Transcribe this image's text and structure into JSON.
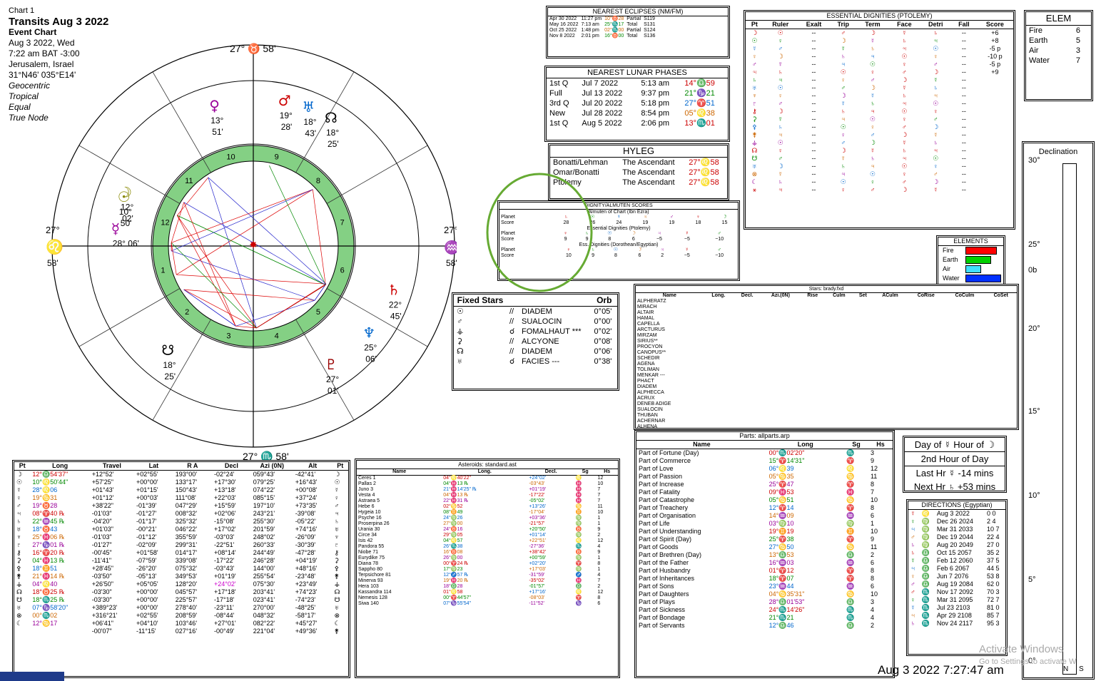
{
  "chart_info": {
    "chart_label": "Chart 1",
    "title": "Transits Aug 3 2022",
    "subtitle": "Event Chart",
    "date": "Aug 3 2022, Wed",
    "time": "7:22 am  BAT -3:00",
    "place": "Jerusalem, Israel",
    "coords": "31°N46' 035°E14'",
    "options": [
      "Geocentric",
      "Tropical",
      "Equal",
      "True Node"
    ]
  },
  "wheel": {
    "cusp_top": "27° ♉ 58'",
    "cusp_bottom": "27° ♏ 58'",
    "cusp_left": "27°",
    "cusp_left_min": "58'",
    "cusp_right": "27°",
    "cusp_right_min": "58'",
    "asc_sign": "♌",
    "dsc_sign": "♒",
    "house_numbers": [
      "1",
      "2",
      "3",
      "4",
      "5",
      "6",
      "7",
      "8",
      "9",
      "10",
      "11",
      "12"
    ],
    "planet_labels": [
      {
        "g": "♀",
        "deg": "13°",
        "sign": "♊",
        "min": "51'"
      },
      {
        "g": "♂",
        "deg": "19°",
        "min": "28'"
      },
      {
        "g": "♅",
        "deg": "18°",
        "min": "43'"
      },
      {
        "g": "☊",
        "deg": "18°",
        "min": "25'"
      },
      {
        "g": "☿",
        "deg": "28° 06'"
      },
      {
        "g": "☉",
        "deg": "10°",
        "min": "50'"
      },
      {
        "g": "♄",
        "deg": "22°",
        "min": "45'"
      },
      {
        "g": "♆",
        "deg": "25°",
        "min": "06'"
      },
      {
        "g": "♇",
        "deg": "27°",
        "min": "01'"
      },
      {
        "g": "☽",
        "deg": "12°",
        "min": "02'"
      },
      {
        "g": "☋",
        "deg": "18°",
        "min": "25'"
      }
    ]
  },
  "eclipses": {
    "title": "NEAREST ECLIPSES (NM/FM)",
    "rows": [
      [
        "Apr 30 2022",
        "11:27 pm",
        "10°♉28",
        "Partial",
        "S119"
      ],
      [
        "May 16 2022",
        "7:13 am",
        "25°♏17",
        "Total",
        "S131"
      ],
      [
        "Oct 25 2022",
        "1:48 pm",
        "02°♏00",
        "Partial",
        "S124"
      ],
      [
        "Nov 8 2022",
        "2:01 pm",
        "16°♉00",
        "Total",
        "S136"
      ]
    ]
  },
  "lunar_phases": {
    "title": "NEAREST LUNAR PHASES",
    "rows": [
      [
        "1st Q",
        "Jul 7 2022",
        "5:13 am",
        "14°♎59"
      ],
      [
        "Full",
        "Jul 13 2022",
        "9:37 pm",
        "21°♑21"
      ],
      [
        "3rd Q",
        "Jul 20 2022",
        "5:18 pm",
        "27°♈51"
      ],
      [
        "New",
        "Jul 28 2022",
        "8:54 pm",
        "05°♌38"
      ],
      [
        "1st Q",
        "Aug 5 2022",
        "2:06 pm",
        "13°♏01"
      ]
    ]
  },
  "hyleg": {
    "title": "HYLEG",
    "rows": [
      [
        "Bonatti/Lehman",
        "The Ascendant",
        "27°♌58"
      ],
      [
        "Omar/Bonatti",
        "The Ascendant",
        "27°♌58"
      ],
      [
        "Ptolemy",
        "The Ascendant",
        "27°♌58"
      ]
    ]
  },
  "dignity_scores": {
    "title": "DIGNITY/ALMUTEN SCORES",
    "s1": "Almuten of Chart (Ibn Ezra)",
    "s2": "Essential Dignities (Ptolemy)",
    "s3": "Ess. Dignities (Dorothean/Egyptian)",
    "planet": "Planet",
    "score": "Score",
    "r1": {
      "g": [
        "♄",
        "☉",
        "☿",
        "♃",
        "♂",
        "♀",
        "☽"
      ],
      "v": [
        "28",
        "26",
        "24",
        "19",
        "19",
        "18",
        "15"
      ]
    },
    "r2": {
      "g": [
        "♀",
        "♄",
        "☉",
        "☽",
        "♃",
        "☿",
        "♂"
      ],
      "v": [
        "9",
        "9",
        "8",
        "6",
        "−5",
        "−5",
        "−10"
      ]
    },
    "r3": {
      "g": [
        "♀",
        "♄",
        "☉",
        "☽",
        "♃",
        "☿",
        "♂"
      ],
      "v": [
        "10",
        "9",
        "8",
        "6",
        "2",
        "−5",
        "−10"
      ]
    }
  },
  "fixed_stars": {
    "col1": "Fixed Stars",
    "col2": "Orb",
    "rows": [
      [
        "☉",
        "//",
        "DIADEM",
        "0°05'"
      ],
      [
        "♂",
        "//",
        "SUALOCIN",
        "0°00'"
      ],
      [
        "⚶",
        "☌",
        "FOMALHAUT ***",
        "0°02'"
      ],
      [
        "⚳",
        "//",
        "ALCYONE",
        "0°08'"
      ],
      [
        "☊",
        "//",
        "DIADEM",
        "0°06'"
      ],
      [
        "♅",
        "☌",
        "FACIES ---",
        "0°38'"
      ]
    ]
  },
  "essential_dignities": {
    "title": "ESSENTIAL DIGNITIES (PTOLEMY)",
    "headers": [
      "Pt",
      "Ruler",
      "Exalt",
      "Trip",
      "Term",
      "Face",
      "Detri",
      "Fall",
      "Score"
    ],
    "scores": [
      "+6",
      "+8",
      "-5 p",
      "-10 p",
      "-5 p",
      "+9"
    ]
  },
  "elem": {
    "title": "ELEM",
    "rows": [
      [
        "Fire",
        "6"
      ],
      [
        "Earth",
        "5"
      ],
      [
        "Air",
        "3"
      ],
      [
        "Water",
        "7"
      ]
    ]
  },
  "elements": {
    "title": "ELEMENTS",
    "rows": [
      {
        "name": "Fire",
        "color": "#ff0000"
      },
      {
        "name": "Earth",
        "color": "#00d000"
      },
      {
        "name": "Air",
        "color": "#40e0ff"
      },
      {
        "name": "Water",
        "color": "#0030ff"
      }
    ]
  },
  "declination": {
    "title": "Declination",
    "ticks": [
      "30°",
      "25°",
      "0b",
      "20°",
      "15°",
      "10°",
      "5°",
      "0°"
    ],
    "bottom": [
      "N",
      "S"
    ]
  },
  "stars_table": {
    "title": "Stars: brady.fxd",
    "headers": [
      "Name",
      "Long.",
      "Decl.",
      "Azi.(0N)",
      "Rise",
      "Culm",
      "Set",
      "ACulm",
      "CoRise",
      "CoCulm",
      "CoSet"
    ],
    "names": [
      "ALPHERATZ",
      "MIRACH",
      "ALTAIR",
      "HAMAL",
      "CAPELLA",
      "ARCTURUS",
      "MIRZAM",
      "SIRIUS**",
      "PROCYON",
      "CANOPUS**",
      "SCHEDIR",
      "AGENA",
      "TOLIMAN",
      "MENKAR ---",
      "PHACT",
      "DIADEM",
      "ALPHECCA",
      "ACRUX",
      "DENEB ADIGE",
      "SUALOCIN",
      "THUBAN",
      "ACHERNAR",
      "ALHENA"
    ]
  },
  "planets": {
    "headers": [
      "Pt",
      "Long",
      "Travel",
      "Lat",
      "R A",
      "Decl",
      "Azi (0N)",
      "Alt",
      "Pt"
    ],
    "rows": [
      [
        "☽",
        "12°♎54'37\"",
        "+12°52'",
        "+02°55'",
        "193°00'",
        "-02°24'",
        "059°43'",
        "-42°41'",
        "☽"
      ],
      [
        "☉",
        "10°♌50'44\"",
        "+57'25\"",
        "+00°00'",
        "133°17'",
        "+17°30'",
        "079°25'",
        "+16°43'",
        "☉"
      ],
      [
        "☿",
        "28°♌06",
        "+01°43'",
        "+01°15'",
        "150°43'",
        "+13°18'",
        "074°22'",
        "+00°08'",
        "☿"
      ],
      [
        "♀",
        "19°♋31",
        "+01°12'",
        "+00°03'",
        "111°08'",
        "+22°03'",
        "085°15'",
        "+37°24'",
        "♀"
      ],
      [
        "♂",
        "19°♉28",
        "+38'22\"",
        "-01°39'",
        "047°29'",
        "+15°59'",
        "197°10'",
        "+73°35'",
        "♂"
      ],
      [
        "♃",
        "08°♈40 ℞",
        "-01'03\"",
        "-01°27'",
        "008°32'",
        "+02°06'",
        "243°21'",
        "-39°08'",
        "♃"
      ],
      [
        "♄",
        "22°♒45 ℞",
        "-04'20\"",
        "-01°17'",
        "325°32'",
        "-15°08'",
        "255°30'",
        "-05°22'",
        "♄"
      ],
      [
        "♅",
        "18°♉43",
        "+01'03\"",
        "-00°21'",
        "046°22'",
        "+17°02'",
        "201°59'",
        "+74°16'",
        "♅"
      ],
      [
        "♆",
        "25°♓06 ℞",
        "-01'03\"",
        "-01°12'",
        "355°59'",
        "-03°03'",
        "248°02'",
        "-26°09'",
        "♆"
      ],
      [
        "♇",
        "27°♑01 ℞",
        "-01'27\"",
        "-02°09'",
        "299°31'",
        "-22°51'",
        "260°33'",
        "-30°39'",
        "♇"
      ],
      [
        "⚷",
        "16°♈20 ℞",
        "-00'45\"",
        "+01°58'",
        "014°17'",
        "+08°14'",
        "244°49'",
        "-47°28'",
        "⚷"
      ],
      [
        "⚳",
        "04°♓13 ℞",
        "-11'41\"",
        "-07°59'",
        "339°08'",
        "-17°22'",
        "246°28'",
        "+04°19'",
        "⚳"
      ],
      [
        "⚴",
        "18°♊51",
        "+28'45\"",
        "-26°20'",
        "075°32'",
        "-03°43'",
        "144°00'",
        "+48°16'",
        "⚴"
      ],
      [
        "⚵",
        "21°♓14 ℞",
        "-03'50\"",
        "-05°13'",
        "349°53'",
        "+01°19'",
        "255°54'",
        "-23°48'",
        "⚵"
      ],
      [
        "⚶",
        "04°♌40",
        "+26'50\"",
        "+05°05'",
        "128°20'",
        "+24°02'",
        "075°30'",
        "+23°49'",
        "⚶"
      ],
      [
        "☊",
        "18°♉25 ℞",
        "-03'30\"",
        "+00°00'",
        "045°57'",
        "+17°18'",
        "203°41'",
        "+74°23'",
        "☊"
      ],
      [
        "☋",
        "18°♏25 ℞",
        "-03'30\"",
        "+00°00'",
        "225°57'",
        "-17°18'",
        "023°41'",
        "-74°23'",
        "☋"
      ],
      [
        "♅",
        "07°♑58'20\"",
        "+389°23'",
        "+00°00'",
        "278°40'",
        "-23°11'",
        "270°00'",
        "-48°25'",
        "♅"
      ],
      [
        "⊗",
        "00°♏02",
        "+316°21'",
        "+02°55'",
        "208°59'",
        "-08°44'",
        "048°32'",
        "-58°17'",
        "⊗"
      ],
      [
        "☾",
        "12°♋17",
        "+06'41\"",
        "+04°10'",
        "103°46'",
        "+27°01'",
        "082°22'",
        "+45°27'",
        "☾"
      ],
      [
        "",
        "",
        "-00'07\"",
        "-11°15'",
        "027°16'",
        "-00°49'",
        "221°04'",
        "+49°36'",
        "⚵"
      ]
    ]
  },
  "asteroids": {
    "title": "Asteroids: standard.ast",
    "headers": [
      "Name",
      "Long.",
      "Decl.",
      "Sg",
      "Hs"
    ],
    "rows": [
      [
        "Ceres 1",
        "04°♌40'22\"",
        "+24°02'",
        "♌",
        "12"
      ],
      [
        "Pallas 2",
        "04°♓13 ℞",
        "-03°43'",
        "♓",
        "10"
      ],
      [
        "Juno 3",
        "21°♓14'25\" ℞",
        "+01°19'",
        "♓",
        "7"
      ],
      [
        "Vesta 4",
        "04°♓13 ℞",
        "-17°22'",
        "♓",
        "7"
      ],
      [
        "Astraea 5",
        "22°♓31 ℞",
        "-05°02'",
        "♓",
        "7"
      ],
      [
        "Hebe 6",
        "02°♋52",
        "+13°26'",
        "♋",
        "11"
      ],
      [
        "Hygeia 10",
        "08°♊49",
        "-17°04'",
        "♊",
        "10"
      ],
      [
        "Psyche 16",
        "24°♍26",
        "+03°36'",
        "♍",
        "1"
      ],
      [
        "Proserpina 26",
        "27°♍00",
        "-21°57'",
        "♍",
        "1"
      ],
      [
        "Urania 30",
        "24°♉16",
        "+20°50'",
        "♉",
        "9"
      ],
      [
        "Circe 34",
        "29°♍05",
        "+01°14'",
        "♍",
        "2"
      ],
      [
        "Isis 42",
        "04°♌57",
        "+22°51'",
        "♌",
        "12"
      ],
      [
        "Pandora 55",
        "26°♏38",
        "-27°36'",
        "♏",
        "4"
      ],
      [
        "Niobe 71",
        "16°♉08",
        "+38°42'",
        "♉",
        "9"
      ],
      [
        "Eurydike 75",
        "26°♍00",
        "+00°59'",
        "♍",
        "1"
      ],
      [
        "Diana 78",
        "00°♈24 ℞",
        "+02°20'",
        "♈",
        "8"
      ],
      [
        "Sappho 80",
        "17°♍23",
        "+17°03'",
        "♍",
        "1"
      ],
      [
        "Terpsichore 81",
        "12°♐57 ℞",
        "-31°59'",
        "♐",
        "4"
      ],
      [
        "Minerva 93",
        "19°♓20 ℞",
        "-35°02'",
        "♓",
        "7"
      ],
      [
        "Hera 103",
        "18°♎28",
        "-01°57'",
        "♎",
        "2"
      ],
      [
        "Kassandra 114",
        "01°♌58",
        "+17°16'",
        "♌",
        "12"
      ],
      [
        "Nemesis 128",
        "00°♈44'57\"",
        "-08°03'",
        "♈",
        "8"
      ],
      [
        "Siwa 140",
        "07°♑55'54\"",
        "-11°52'",
        "♑",
        "6"
      ]
    ]
  },
  "parts": {
    "title": "Parts: allparts.arp",
    "headers": [
      "Name",
      "Long",
      "Sg",
      "Hs"
    ],
    "rows": [
      [
        "Part of Fortune (Day)",
        "00°♏02'20\"",
        "♏",
        "3"
      ],
      [
        "Part of Commerce",
        "15°♈14'31\"",
        "♈",
        "9"
      ],
      [
        "Part of Love",
        "06°♌39",
        "♌",
        "12"
      ],
      [
        "Part of Passion",
        "05°♋35",
        "♋",
        "11"
      ],
      [
        "Part of Increase",
        "25°♈47",
        "♈",
        "8"
      ],
      [
        "Part of Fatality",
        "09°♓53",
        "♓",
        "7"
      ],
      [
        "Part of Catastrophe",
        "05°♋51",
        "♋",
        "10"
      ],
      [
        "Part of Treachery",
        "12°♈14",
        "♈",
        "8"
      ],
      [
        "Part of Organisation",
        "14°♒09",
        "♒",
        "6"
      ],
      [
        "Part of Life",
        "03°♍10",
        "♍",
        "1"
      ],
      [
        "Part of Understanding",
        "19°♊19",
        "♊",
        "10"
      ],
      [
        "Part of Spirit (Day)",
        "25°♈38",
        "♈",
        "9"
      ],
      [
        "Part of Goods",
        "27°♋50",
        "♋",
        "11"
      ],
      [
        "Part of Brethren (Day)",
        "13°♎53",
        "♎",
        "2"
      ],
      [
        "Part of the Father",
        "16°♒03",
        "♒",
        "6"
      ],
      [
        "Part of Husbandry",
        "01°♈12",
        "♈",
        "8"
      ],
      [
        "Part of Inheritances",
        "18°♈07",
        "♈",
        "8"
      ],
      [
        "Part of Sons",
        "23°♒44",
        "♒",
        "6"
      ],
      [
        "Part of Daughters",
        "04°♋35'31\"",
        "♋",
        "10"
      ],
      [
        "Part of Plays",
        "28°♎01'53\"",
        "♎",
        "3"
      ],
      [
        "Part of Sickness",
        "24°♏14'26\"",
        "♏",
        "4"
      ],
      [
        "Part of Bondage",
        "21°♏21",
        "♏",
        "4"
      ],
      [
        "Part of Servants",
        "12°♎46",
        "♎",
        "2"
      ]
    ]
  },
  "day_hour": {
    "row1": "Day of ☿   Hour of ☽",
    "row2": "2nd Hour of Day",
    "row3": "Last Hr ☿  -14 mins",
    "row4": "Next Hr ♄  +53 mins"
  },
  "directions": {
    "title": "DIRECTIONS (Egyptian)",
    "rows": [
      [
        "☿",
        "♌",
        "Aug 3 2022",
        "0 0"
      ],
      [
        "♀",
        "♍",
        "Dec 26 2024",
        "2 4"
      ],
      [
        "♃",
        "♍",
        "Mar 31 2033",
        "10 7"
      ],
      [
        "♂",
        "♍",
        "Dec 19 2044",
        "22 4"
      ],
      [
        "♄",
        "♍",
        "Aug 20 2049",
        "27 0"
      ],
      [
        "♄",
        "♎",
        "Oct 15 2057",
        "35 2"
      ],
      [
        "☿",
        "♎",
        "Feb 12 2060",
        "37 5"
      ],
      [
        "♃",
        "♎",
        "Feb 6 2067",
        "44 5"
      ],
      [
        "♀",
        "♎",
        "Jun 7 2076",
        "53 8"
      ],
      [
        "♂",
        "♎",
        "Aug 19 2084",
        "62 0"
      ],
      [
        "♂",
        "♏",
        "Nov 17 2092",
        "70 3"
      ],
      [
        "♀",
        "♏",
        "Mar 31 2095",
        "72 7"
      ],
      [
        "☿",
        "♏",
        "Jul 23 2103",
        "81 0"
      ],
      [
        "♃",
        "♏",
        "Apr 29 2108",
        "85 7"
      ],
      [
        "♄",
        "♏",
        "Nov 24 2117",
        "95 3"
      ]
    ]
  },
  "status": {
    "clock": "Aug 3 2022  7:27:47 am",
    "watermark1": "Activate Windows",
    "watermark2": "Go to Settings to activate W"
  }
}
